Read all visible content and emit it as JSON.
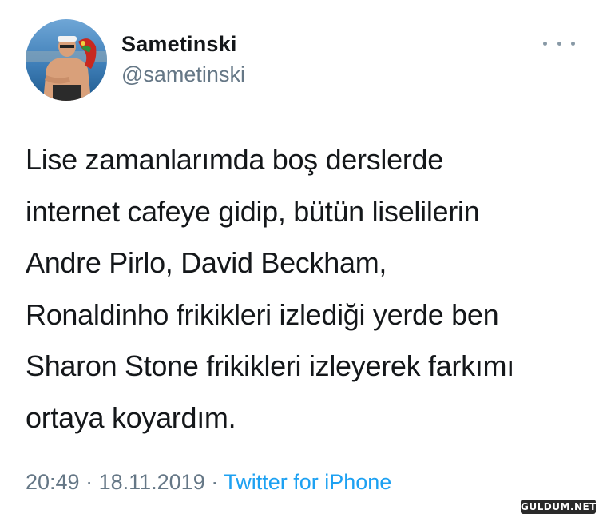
{
  "user": {
    "display_name": "Sametinski",
    "handle": "@sametinski"
  },
  "tweet": {
    "lines": [
      "Lise zamanlarımda boş derslerde",
      "internet cafeye gidip, bütün liselilerin",
      "Andre Pirlo, David Beckham,",
      "Ronaldinho frikikleri izlediği yerde ben",
      "Sharon Stone frikikleri izleyerek farkımı",
      "ortaya koyardım."
    ],
    "time": "20:49",
    "separator": " · ",
    "date": "18.11.2019",
    "source": "Twitter for iPhone"
  },
  "watermark": "GULDUM.NET",
  "icons": {
    "more": "more-horizontal-icon",
    "avatar": "profile-photo"
  },
  "colors": {
    "text": "#14171a",
    "secondary": "#657786",
    "link": "#1da1f2"
  }
}
